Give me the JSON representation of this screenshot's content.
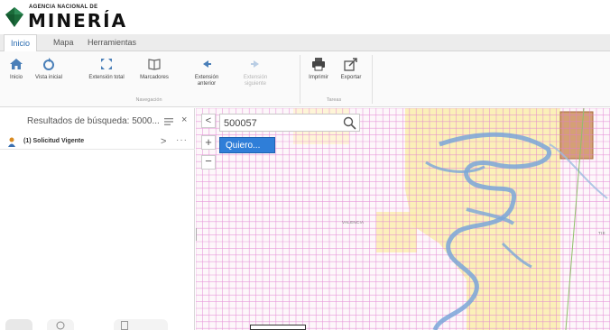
{
  "header": {
    "agency_small": "AGENCIA NACIONAL DE",
    "agency_big": "MINERÍA"
  },
  "tabs": [
    {
      "label": "Inicio",
      "active": true
    },
    {
      "label": "Mapa",
      "active": false
    },
    {
      "label": "Herramientas",
      "active": false
    }
  ],
  "ribbon": {
    "navigation_buttons": [
      {
        "label": "Inicio",
        "icon": "home-icon"
      },
      {
        "label": "Vista inicial",
        "icon": "initial-view-icon"
      },
      {
        "label": "Extensión total",
        "icon": "full-extent-icon"
      },
      {
        "label": "Marcadores",
        "icon": "bookmarks-icon"
      },
      {
        "label": "Extensión anterior",
        "icon": "previous-extent-icon"
      },
      {
        "label": "Extensión siguiente",
        "icon": "next-extent-icon",
        "disabled": true
      }
    ],
    "navigation_group": "Navegación",
    "task_buttons": [
      {
        "label": "Imprimir",
        "icon": "print-icon"
      },
      {
        "label": "Exportar",
        "icon": "export-icon"
      }
    ],
    "tasks_group": "Tareas"
  },
  "left_panel": {
    "title": "Resultados de búsqueda: 5000...",
    "close": "×",
    "results": [
      {
        "label": "(1) Solicitud Vigente",
        "chevron": ">",
        "more": "···"
      }
    ]
  },
  "map": {
    "collapse": "<",
    "zoom_in": "+",
    "zoom_out": "−",
    "search_value": "500057",
    "quiero_label": "Quiero...",
    "place_label": "VALENCIA",
    "place_label_right": "TIE"
  },
  "colors": {
    "accent": "#2f7ed8",
    "grid": "#e07ad0",
    "yellow_zone": "#fbeeb0",
    "river": "#7aa6d8",
    "title_block": "#d4a075"
  }
}
